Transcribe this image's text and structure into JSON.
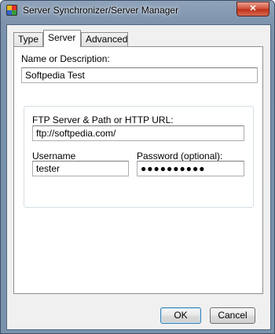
{
  "window": {
    "title": "Server Synchronizer/Server Manager",
    "close_label": "✕",
    "app_icon": "app-icon"
  },
  "tabs": [
    {
      "label": "Type",
      "active": false
    },
    {
      "label": "Server",
      "active": true
    },
    {
      "label": "Advanced",
      "active": false
    }
  ],
  "form": {
    "name_label": "Name or Description:",
    "name_value": "Softpedia Test",
    "ftp_label": "FTP Server & Path or HTTP URL:",
    "ftp_value": "ftp://softpedia.com/",
    "username_label": "Username",
    "username_value": "tester",
    "password_label": "Password (optional):",
    "password_value": "●●●●●●●●●●"
  },
  "buttons": {
    "ok_label": "OK",
    "cancel_label": "Cancel"
  }
}
